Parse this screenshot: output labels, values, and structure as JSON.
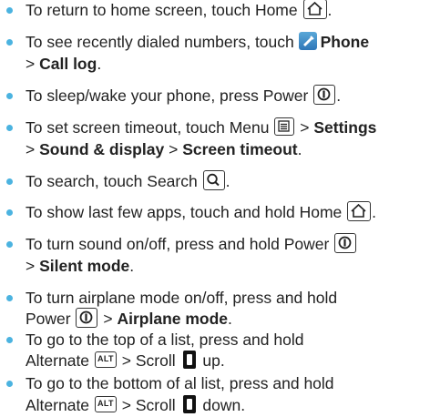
{
  "items": [
    {
      "t1": "To return to home screen, touch Home",
      "t2": "."
    },
    {
      "t1": "To see recently dialed numbers, touch",
      "b1": "Phone",
      "t2": ">",
      "b2": "Call log",
      "t3": "."
    },
    {
      "t1": "To sleep/wake your phone, press Power",
      "t2": "."
    },
    {
      "t1": "To set screen timeout, touch Menu",
      "t2": ">",
      "b1": "Settings",
      "t3": ">",
      "b2": "Sound & display",
      "t4": ">",
      "b3": "Screen timeout",
      "t5": "."
    },
    {
      "t1": "To search, touch Search",
      "t2": "."
    },
    {
      "t1": "To show last few apps, touch and hold Home",
      "t2": "."
    },
    {
      "t1": "To turn sound on/off, press and hold Power",
      "t2": ">",
      "b1": "Silent mode",
      "t3": "."
    },
    {
      "t1": "To turn airplane mode on/off, press and hold",
      "t2": "Power",
      "t3": ">",
      "b1": "Airplane mode",
      "t4": "."
    },
    {
      "t1": "To go to the top of a list, press and hold",
      "t2": "Alternate",
      "t3": "> Scroll",
      "t4": "up."
    },
    {
      "t1": "To go to the bottom of al list, press and hold",
      "t2": "Alternate",
      "t3": "> Scroll",
      "t4": "down."
    }
  ],
  "keys": {
    "alt": "ALT"
  },
  "colors": {
    "bullet": "#4bb3e0",
    "text": "#222222"
  },
  "icons": [
    "home-key-icon",
    "power-key-icon",
    "menu-key-icon",
    "search-key-icon",
    "alt-key-icon",
    "scroll-key-icon",
    "phone-app-icon"
  ]
}
